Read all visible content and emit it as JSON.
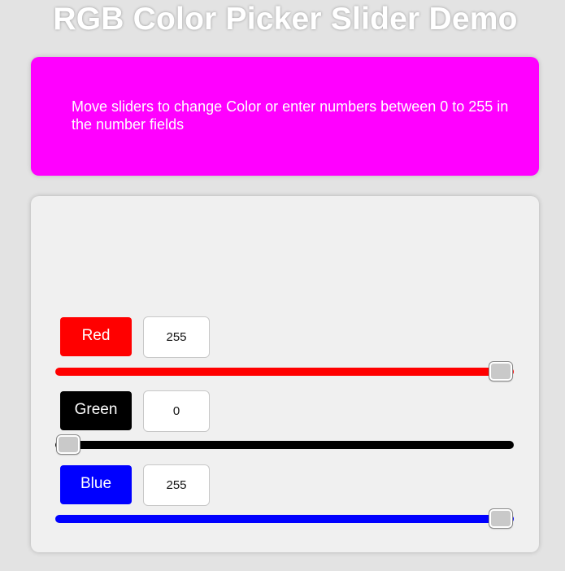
{
  "page": {
    "title": "RGB Color Picker Slider Demo"
  },
  "display": {
    "instructions": "Move sliders to change Color or enter numbers between 0 to 255 in the number fields",
    "background": "#ff00ff"
  },
  "range": {
    "min": 0,
    "max": 255
  },
  "channels": {
    "red": {
      "label": "Red",
      "value": "255",
      "level": 255,
      "color": "#ff0000"
    },
    "green": {
      "label": "Green",
      "value": "0",
      "level": 0,
      "color": "#000000"
    },
    "blue": {
      "label": "Blue",
      "value": "255",
      "level": 255,
      "color": "#0000ff"
    }
  }
}
